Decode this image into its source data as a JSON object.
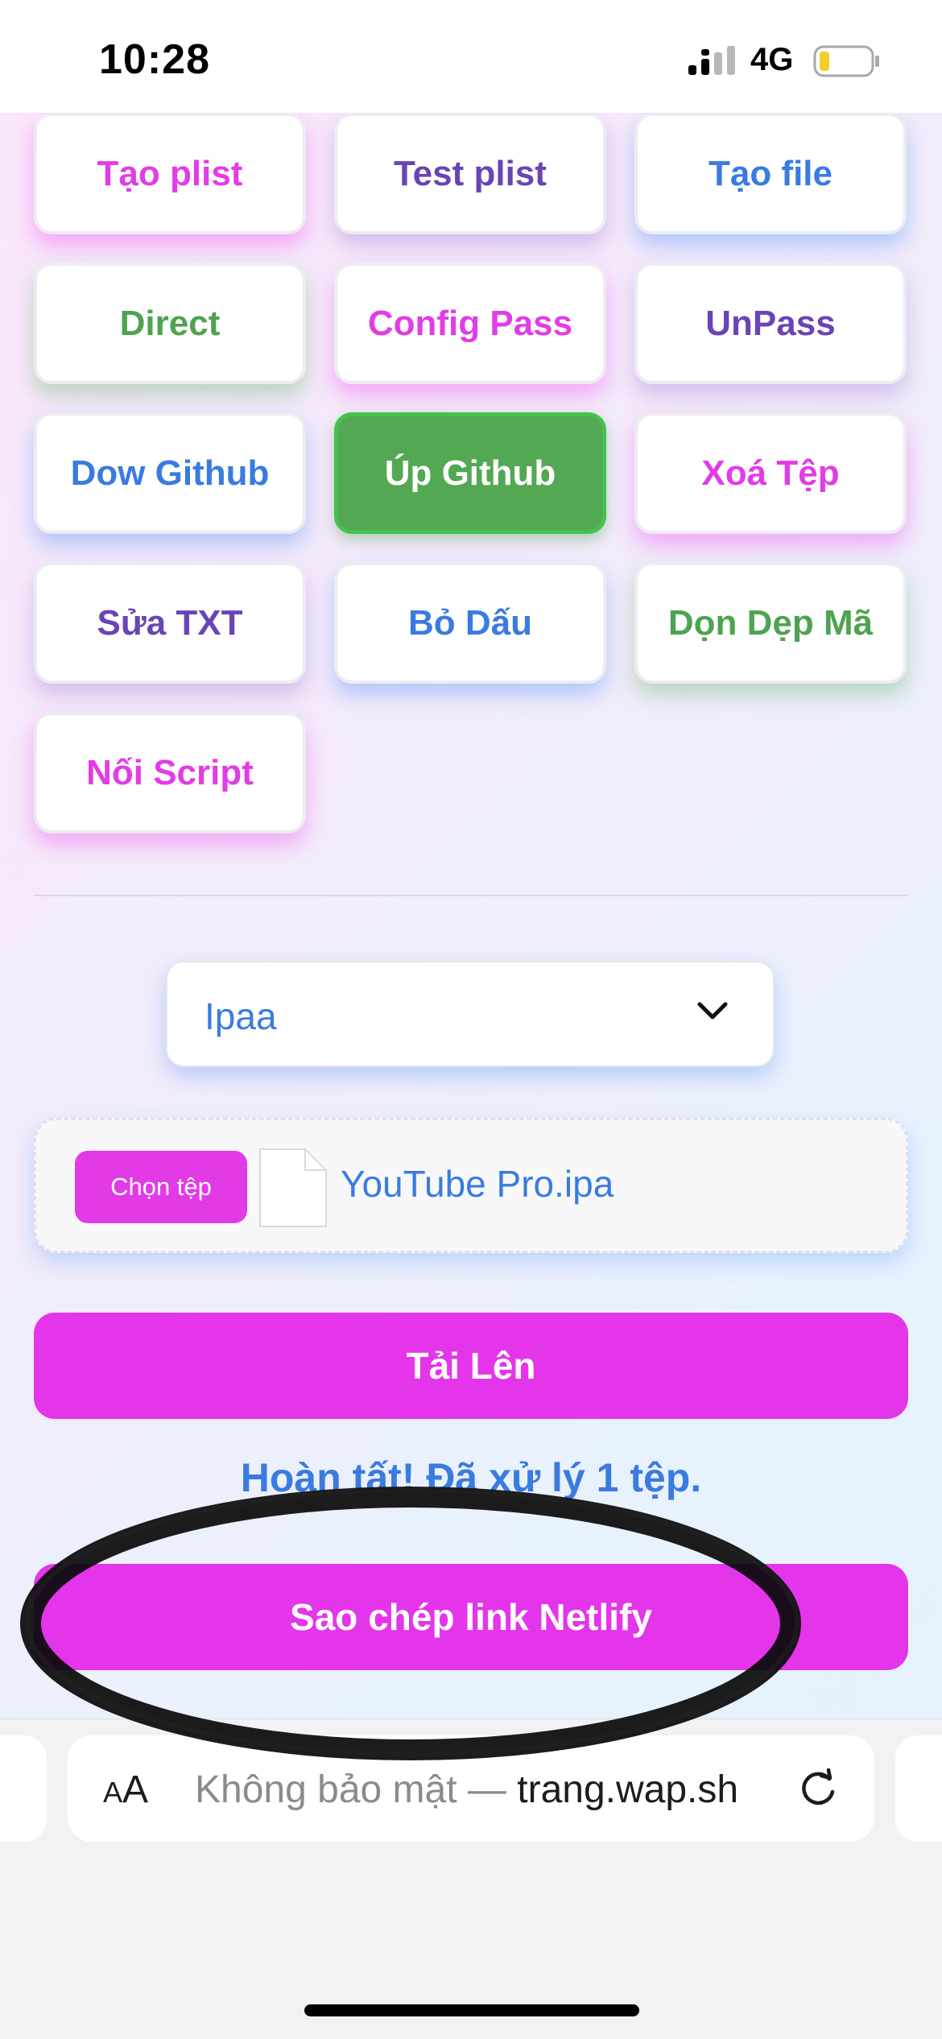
{
  "status_bar": {
    "time": "10:28",
    "network": "4G"
  },
  "tools": [
    {
      "label": "Tạo plist",
      "color": "pink"
    },
    {
      "label": "Test plist",
      "color": "purple"
    },
    {
      "label": "Tạo file",
      "color": "blue"
    },
    {
      "label": "Direct",
      "color": "green"
    },
    {
      "label": "Config Pass",
      "color": "pink"
    },
    {
      "label": "UnPass",
      "color": "purple"
    },
    {
      "label": "Dow Github",
      "color": "blue"
    },
    {
      "label": "Úp Github",
      "color": "active"
    },
    {
      "label": "Xoá Tệp",
      "color": "pink"
    },
    {
      "label": "Sửa TXT",
      "color": "purple"
    },
    {
      "label": "Bỏ Dấu",
      "color": "blue"
    },
    {
      "label": "Dọn Dẹp Mã",
      "color": "green"
    },
    {
      "label": "Nối Script",
      "color": "pink"
    }
  ],
  "select": {
    "value": "Ipaa",
    "icon": "chevron-down-icon"
  },
  "file_picker": {
    "button_label": "Chọn tệp",
    "file_name": "YouTube Pro.ipa",
    "icon": "file-icon"
  },
  "upload_label": "Tải Lên",
  "status_message": "Hoàn tất! Đã xử lý 1 tệp.",
  "copy_link_label": "Sao chép link Netlify",
  "browser": {
    "reader_small": "A",
    "reader_big": "A",
    "url_muted": "Không bảo mật — ",
    "url_domain": "trang.wap.sh"
  },
  "colors": {
    "pink": "#e23ce6",
    "purple": "#6a44b6",
    "blue": "#3a7be0",
    "green": "#4ea350",
    "active_bg": "#53a854",
    "primary_button": "#e535ea"
  }
}
